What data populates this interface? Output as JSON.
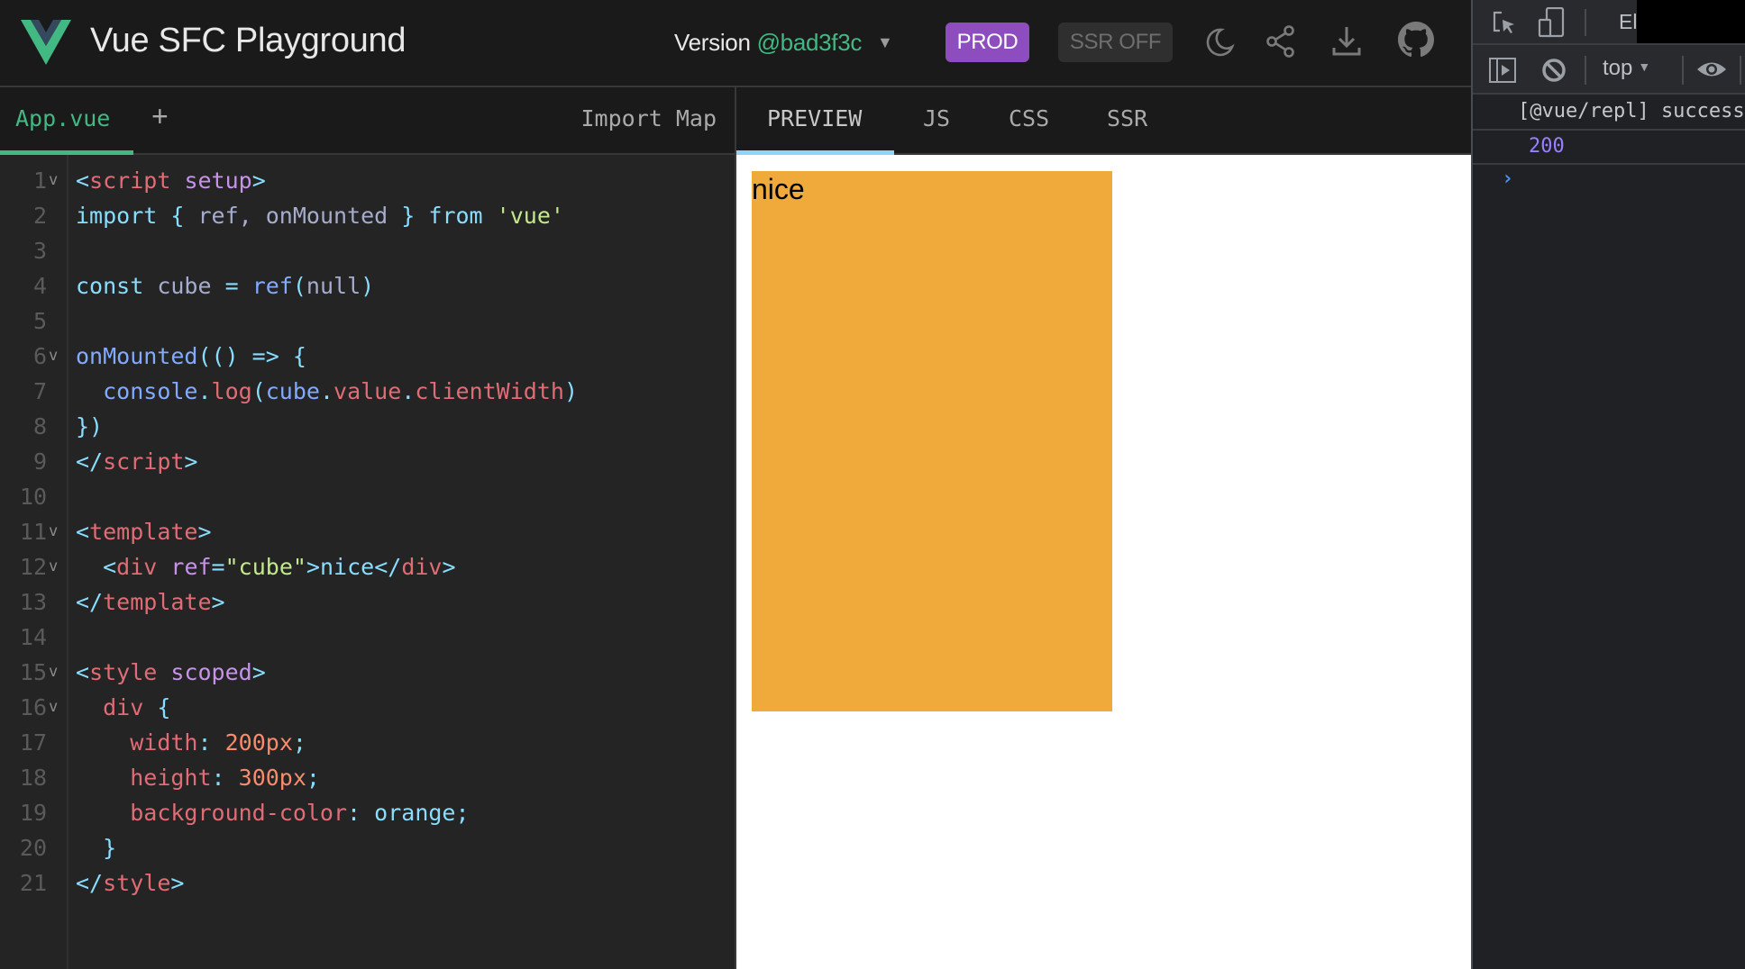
{
  "header": {
    "app_title": "Vue SFC Playground",
    "version_label": "Version",
    "version_value": "@bad3f3c",
    "version_caret": "▼",
    "prod_button": "PROD",
    "ssr_button": "SSR OFF",
    "icons": [
      "moon-icon",
      "share-icon",
      "download-icon",
      "github-icon"
    ],
    "colors": {
      "brand": "#42b883",
      "prod": "#8e4dbf"
    }
  },
  "editor": {
    "file_tabs": [
      {
        "label": "App.vue",
        "active": true
      }
    ],
    "add_file": "+",
    "import_map": "Import Map",
    "lines": [
      {
        "n": "1",
        "fold": true,
        "tokens": [
          [
            "c-punc",
            "<"
          ],
          [
            "c-tag",
            "script"
          ],
          [
            "c-var",
            " "
          ],
          [
            "c-attr",
            "setup"
          ],
          [
            "c-punc",
            ">"
          ]
        ]
      },
      {
        "n": "2",
        "fold": false,
        "tokens": [
          [
            "c-kw",
            "import"
          ],
          [
            "c-var",
            " "
          ],
          [
            "c-punc",
            "{"
          ],
          [
            "c-var",
            " ref, onMounted "
          ],
          [
            "c-punc",
            "}"
          ],
          [
            "c-var",
            " "
          ],
          [
            "c-kw",
            "from"
          ],
          [
            "c-var",
            " "
          ],
          [
            "c-str",
            "'vue'"
          ]
        ]
      },
      {
        "n": "3",
        "fold": false,
        "tokens": []
      },
      {
        "n": "4",
        "fold": false,
        "tokens": [
          [
            "c-kw",
            "const"
          ],
          [
            "c-var",
            " cube "
          ],
          [
            "c-punc",
            "="
          ],
          [
            "c-var",
            " "
          ],
          [
            "c-fn",
            "ref"
          ],
          [
            "c-punc",
            "("
          ],
          [
            "c-var",
            "null"
          ],
          [
            "c-punc",
            ")"
          ]
        ]
      },
      {
        "n": "5",
        "fold": false,
        "tokens": []
      },
      {
        "n": "6",
        "fold": true,
        "tokens": [
          [
            "c-fn",
            "onMounted"
          ],
          [
            "c-punc",
            "(() =>"
          ],
          [
            "c-var",
            " "
          ],
          [
            "c-punc",
            "{"
          ]
        ]
      },
      {
        "n": "7",
        "fold": false,
        "tokens": [
          [
            "c-var",
            "  "
          ],
          [
            "c-fn",
            "console"
          ],
          [
            "c-punc",
            "."
          ],
          [
            "c-tag",
            "log"
          ],
          [
            "c-punc",
            "("
          ],
          [
            "c-fn",
            "cube"
          ],
          [
            "c-punc",
            "."
          ],
          [
            "c-tag",
            "value"
          ],
          [
            "c-punc",
            "."
          ],
          [
            "c-tag",
            "clientWidth"
          ],
          [
            "c-punc",
            ")"
          ]
        ]
      },
      {
        "n": "8",
        "fold": false,
        "tokens": [
          [
            "c-punc",
            "})"
          ]
        ]
      },
      {
        "n": "9",
        "fold": false,
        "tokens": [
          [
            "c-punc",
            "</"
          ],
          [
            "c-tag",
            "script"
          ],
          [
            "c-punc",
            ">"
          ]
        ]
      },
      {
        "n": "10",
        "fold": false,
        "tokens": []
      },
      {
        "n": "11",
        "fold": true,
        "tokens": [
          [
            "c-punc",
            "<"
          ],
          [
            "c-tag",
            "template"
          ],
          [
            "c-punc",
            ">"
          ]
        ]
      },
      {
        "n": "12",
        "fold": true,
        "tokens": [
          [
            "c-var",
            "  "
          ],
          [
            "c-punc",
            "<"
          ],
          [
            "c-tag",
            "div"
          ],
          [
            "c-var",
            " "
          ],
          [
            "c-attr",
            "ref"
          ],
          [
            "c-punc",
            "="
          ],
          [
            "c-str",
            "\"cube\""
          ],
          [
            "c-punc",
            ">"
          ],
          [
            "c-text",
            "nice"
          ],
          [
            "c-punc",
            "</"
          ],
          [
            "c-tag",
            "div"
          ],
          [
            "c-punc",
            ">"
          ]
        ]
      },
      {
        "n": "13",
        "fold": false,
        "tokens": [
          [
            "c-punc",
            "</"
          ],
          [
            "c-tag",
            "template"
          ],
          [
            "c-punc",
            ">"
          ]
        ]
      },
      {
        "n": "14",
        "fold": false,
        "tokens": []
      },
      {
        "n": "15",
        "fold": true,
        "tokens": [
          [
            "c-punc",
            "<"
          ],
          [
            "c-tag",
            "style"
          ],
          [
            "c-var",
            " "
          ],
          [
            "c-attr",
            "scoped"
          ],
          [
            "c-punc",
            ">"
          ]
        ]
      },
      {
        "n": "16",
        "fold": true,
        "tokens": [
          [
            "c-var",
            "  "
          ],
          [
            "c-tag",
            "div"
          ],
          [
            "c-var",
            " "
          ],
          [
            "c-punc",
            "{"
          ]
        ]
      },
      {
        "n": "17",
        "fold": false,
        "tokens": [
          [
            "c-var",
            "    "
          ],
          [
            "c-prop",
            "width"
          ],
          [
            "c-punc",
            ":"
          ],
          [
            "c-var",
            " "
          ],
          [
            "c-num",
            "200px"
          ],
          [
            "c-punc",
            ";"
          ]
        ]
      },
      {
        "n": "18",
        "fold": false,
        "tokens": [
          [
            "c-var",
            "    "
          ],
          [
            "c-prop",
            "height"
          ],
          [
            "c-punc",
            ":"
          ],
          [
            "c-var",
            " "
          ],
          [
            "c-num",
            "300px"
          ],
          [
            "c-punc",
            ";"
          ]
        ]
      },
      {
        "n": "19",
        "fold": false,
        "tokens": [
          [
            "c-var",
            "    "
          ],
          [
            "c-prop",
            "background-color"
          ],
          [
            "c-punc",
            ":"
          ],
          [
            "c-var",
            " "
          ],
          [
            "c-val",
            "orange"
          ],
          [
            "c-punc",
            ";"
          ]
        ]
      },
      {
        "n": "20",
        "fold": false,
        "tokens": [
          [
            "c-var",
            "  "
          ],
          [
            "c-punc",
            "}"
          ]
        ]
      },
      {
        "n": "21",
        "fold": false,
        "tokens": [
          [
            "c-punc",
            "</"
          ],
          [
            "c-tag",
            "style"
          ],
          [
            "c-punc",
            ">"
          ]
        ]
      }
    ]
  },
  "output": {
    "tabs": [
      {
        "label": "PREVIEW",
        "active": true
      },
      {
        "label": "JS",
        "active": false
      },
      {
        "label": "CSS",
        "active": false
      },
      {
        "label": "SSR",
        "active": false
      }
    ],
    "preview_text": "nice",
    "preview_color": "#f0a93b"
  },
  "devtools": {
    "tab_elements": "Elements",
    "context": "top",
    "context_caret": "▼",
    "logs": [
      {
        "text": "[@vue/repl] successfully compiled",
        "type": "log"
      },
      {
        "text": "200",
        "type": "number"
      }
    ],
    "prompt": "›"
  }
}
